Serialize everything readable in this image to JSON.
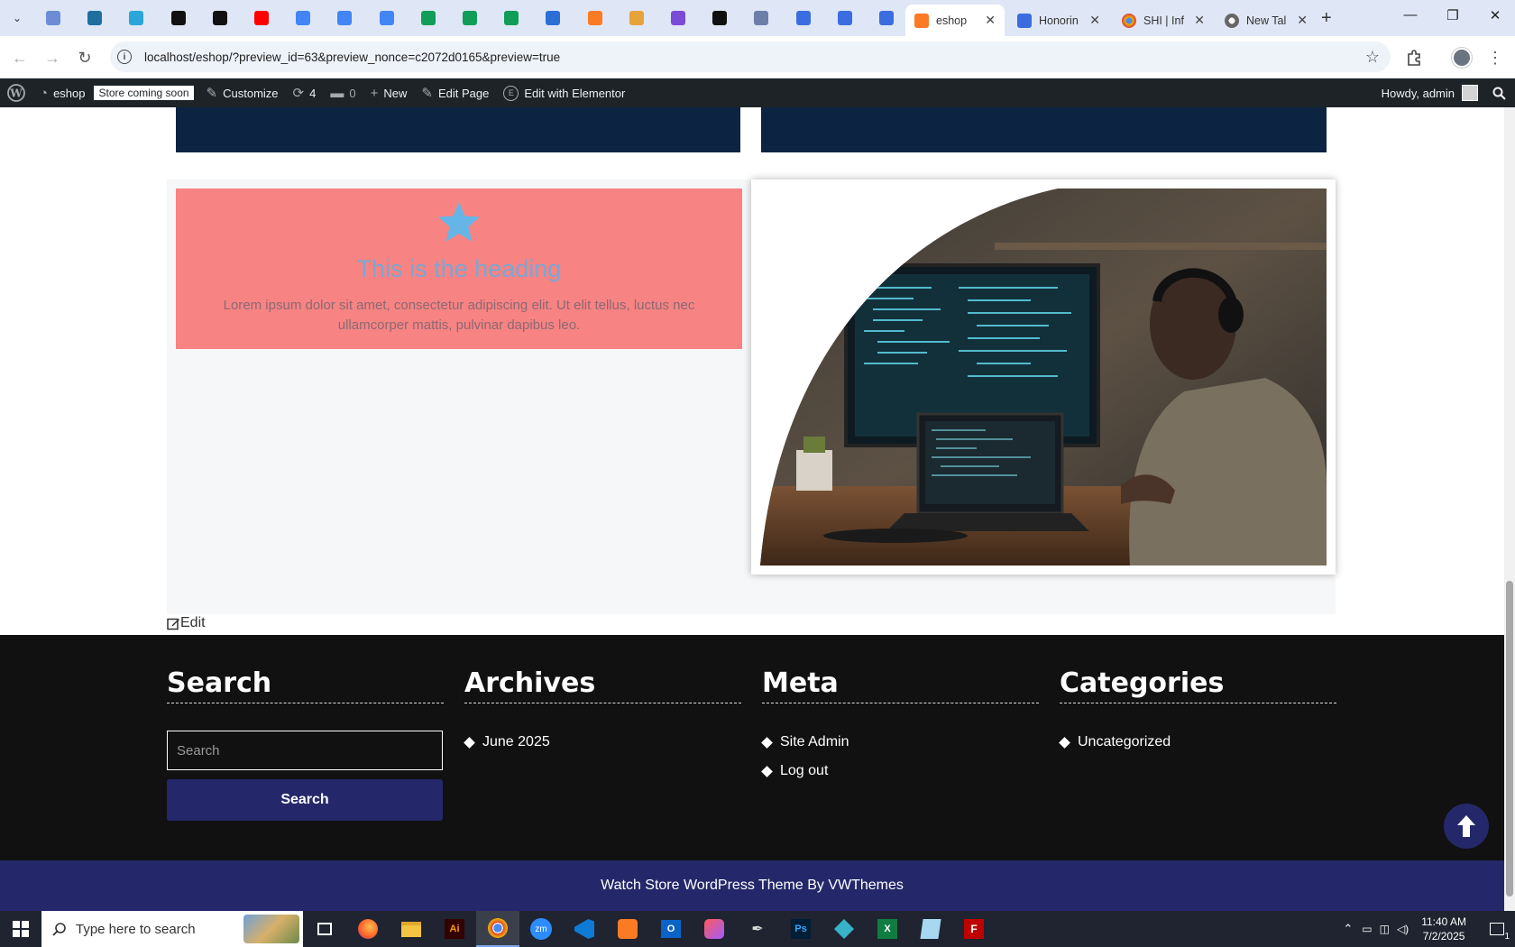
{
  "browser": {
    "pinned_tabs": [
      {
        "icon": "globe-icon",
        "color": "#6c8cd5"
      },
      {
        "icon": "shield-icon",
        "color": "#1f6f9f"
      },
      {
        "icon": "arrow-icon",
        "color": "#2aa6d8"
      },
      {
        "icon": "openai-icon",
        "color": "#111111"
      },
      {
        "icon": "bolt-icon",
        "color": "#111111"
      },
      {
        "icon": "youtube-icon",
        "color": "#ff0000"
      },
      {
        "icon": "docs-icon",
        "color": "#4285f4"
      },
      {
        "icon": "docs-icon",
        "color": "#4285f4"
      },
      {
        "icon": "docs-icon",
        "color": "#4285f4"
      },
      {
        "icon": "sheets-icon",
        "color": "#0f9d58"
      },
      {
        "icon": "sheets-icon",
        "color": "#0f9d58"
      },
      {
        "icon": "sheets-icon",
        "color": "#0f9d58"
      },
      {
        "icon": "ms-icon",
        "color": "#2b6fd6"
      },
      {
        "icon": "xampp-icon",
        "color": "#fb7a24"
      },
      {
        "icon": "fox-icon",
        "color": "#e8a23a"
      },
      {
        "icon": "regex-icon",
        "color": "#7a4bd6"
      },
      {
        "icon": "a-icon",
        "color": "#111111"
      },
      {
        "icon": "grid-icon",
        "color": "#6d7fa8"
      },
      {
        "icon": "forms-icon",
        "color": "#3b6de0"
      },
      {
        "icon": "forms-icon",
        "color": "#3b6de0"
      },
      {
        "icon": "forms-icon",
        "color": "#3b6de0"
      }
    ],
    "tabs": [
      {
        "title": "eshop",
        "icon": "xampp-icon",
        "color": "#fb7a24",
        "active": true
      },
      {
        "title": "Honorin",
        "icon": "forms-icon",
        "color": "#3b6de0",
        "active": false
      },
      {
        "title": "SHI | Inf",
        "icon": "chrome-icon",
        "color": "#e8a23a",
        "active": false
      },
      {
        "title": "New Tal",
        "icon": "chrome-icon",
        "color": "#666666",
        "active": false
      }
    ],
    "url": "localhost/eshop/?preview_id=63&preview_nonce=c2072d0165&preview=true"
  },
  "adminbar": {
    "site_name": "eshop",
    "store_badge": "Store coming soon",
    "customize": "Customize",
    "updates_count": "4",
    "comments_count": "0",
    "new": "New",
    "edit_page": "Edit Page",
    "edit_elementor": "Edit with Elementor",
    "howdy": "Howdy, admin"
  },
  "content": {
    "iconbox_heading": "This is the heading",
    "iconbox_text": "Lorem ipsum dolor sit amet, consectetur adipiscing elit. Ut elit tellus, luctus nec ullamcorper mattis, pulvinar dapibus leo.",
    "edit_link": "Edit",
    "accent_colors": {
      "navy": "#0c2442",
      "salmon": "#f88383",
      "heading_blue": "#7aa7d3"
    }
  },
  "footer": {
    "search": {
      "title": "Search",
      "placeholder": "Search",
      "button": "Search"
    },
    "archives": {
      "title": "Archives",
      "items": [
        "June 2025"
      ]
    },
    "meta": {
      "title": "Meta",
      "items": [
        "Site Admin",
        "Log out"
      ]
    },
    "categories": {
      "title": "Categories",
      "items": [
        "Uncategorized"
      ]
    },
    "copyright": "Watch Store WordPress Theme By VWThemes",
    "button_color": "#24286a"
  },
  "taskbar": {
    "search_placeholder": "Type here to search",
    "time": "11:40 AM",
    "date": "7/2/2025",
    "notification_count": "1"
  }
}
